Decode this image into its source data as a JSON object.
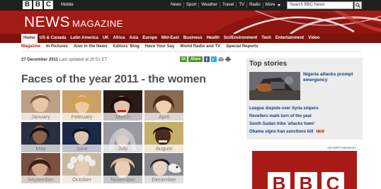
{
  "topbar": {
    "logo_letters": [
      "B",
      "B",
      "C"
    ],
    "mobile": "Mobile",
    "nav": [
      "News",
      "Sport",
      "Weather",
      "Travel",
      "TV",
      "Radio"
    ],
    "more": "More",
    "search_placeholder": "Search BBC News"
  },
  "masthead": {
    "news": "NEWS",
    "magazine": "MAGAZINE"
  },
  "section_nav": [
    "Home",
    "US & Canada",
    "Latin America",
    "UK",
    "Africa",
    "Asia",
    "Europe",
    "Mid-East",
    "Business",
    "Health",
    "Sci/Environment",
    "Tech",
    "Entertainment",
    "Video"
  ],
  "sub_nav": [
    "Magazine",
    "In Pictures",
    "Also in the News",
    "Editors' Blog",
    "Have Your Say",
    "World Radio and TV",
    "Special Reports"
  ],
  "article": {
    "date": "27 December 2011",
    "updated": "Last updated at 20:51 ET",
    "share_count": "1K",
    "share_label": "Share",
    "headline": "Faces of the year 2011 - the women",
    "months": [
      "January",
      "February",
      "March",
      "April",
      "May",
      "June",
      "July",
      "August",
      "September",
      "October",
      "November",
      "December"
    ]
  },
  "top_stories": {
    "title": "Top stories",
    "lead": "Nigeria attacks prompt emergency",
    "stories": [
      {
        "text": "League dispute over Syria snipers",
        "new": ""
      },
      {
        "text": "Revellers mark turn of the year",
        "new": ""
      },
      {
        "text": "South Sudan tribe 'attacks town'",
        "new": ""
      },
      {
        "text": "Obama signs Iran sanctions bill",
        "new": "NEW"
      }
    ]
  },
  "advert": {
    "label": "ADVERTISEMENT",
    "logo_letters": [
      "B",
      "B",
      "C"
    ]
  },
  "colors": {
    "bbc_red": "#a31b14",
    "nav_red": "#7d120c",
    "link_blue": "#0a3a8a",
    "share_green": "#4e9a27"
  }
}
